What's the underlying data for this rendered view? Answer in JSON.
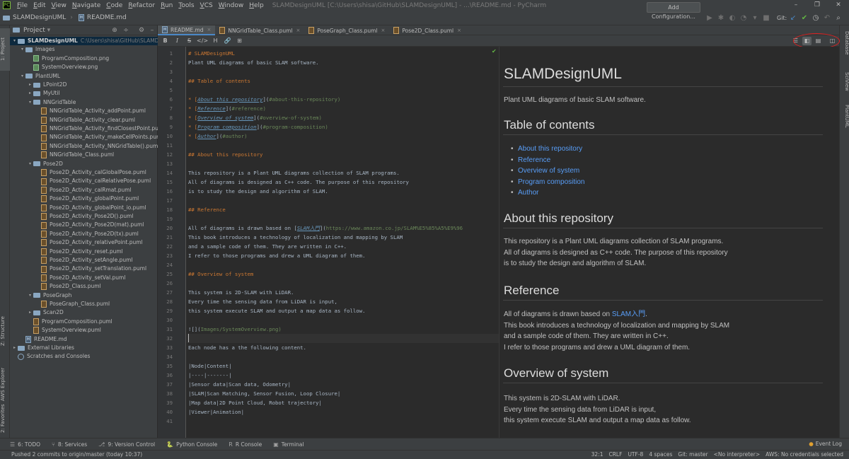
{
  "window": {
    "title": "SLAMDesignUML [C:\\Users\\shisa\\GitHub\\SLAMDesignUML] - ...\\README.md - PyCharm",
    "controls": [
      "–",
      "❐",
      "✕"
    ]
  },
  "menu": [
    {
      "ul": "F",
      "rest": "ile"
    },
    {
      "ul": "E",
      "rest": "dit"
    },
    {
      "ul": "V",
      "rest": "iew"
    },
    {
      "ul": "N",
      "rest": "avigate"
    },
    {
      "ul": "C",
      "rest": "ode"
    },
    {
      "ul": "R",
      "rest": "efactor"
    },
    {
      "ul": "R",
      "rest": "un"
    },
    {
      "ul": "T",
      "rest": "ools"
    },
    {
      "ul": "V",
      "rest": "CS"
    },
    {
      "ul": "W",
      "rest": "indow"
    },
    {
      "ul": "H",
      "rest": "elp"
    }
  ],
  "breadcrumb": {
    "project": "SLAMDesignUML",
    "file": "README.md"
  },
  "toolbar": {
    "add_config": "Add Configuration...",
    "git_label": "Git:"
  },
  "left_tool_tabs": {
    "project": "1: Project",
    "structure": "Z: Structure",
    "aws": "AWS Explorer",
    "favorites": "2: Favorites"
  },
  "right_tool_tabs": {
    "database": "Database",
    "sciview": "SciView",
    "plantuml": "PlantUML"
  },
  "project_panel": {
    "title": "Project",
    "root": {
      "name": "SLAMDesignUML",
      "path": "C:\\Users\\shisa\\GitHub\\SLAMDesignUML"
    },
    "items": [
      {
        "label": "Images",
        "icon": "folder",
        "arrow": "▾",
        "level": 1
      },
      {
        "label": "ProgramComposition.png",
        "icon": "png",
        "arrow": "",
        "level": 2
      },
      {
        "label": "SystemOverview.png",
        "icon": "png",
        "arrow": "",
        "level": 2
      },
      {
        "label": "PlantUML",
        "icon": "folder",
        "arrow": "▾",
        "level": 1
      },
      {
        "label": "LPoint2D",
        "icon": "folder",
        "arrow": "▸",
        "level": 2
      },
      {
        "label": "MyUtil",
        "icon": "folder",
        "arrow": "▸",
        "level": 2
      },
      {
        "label": "NNGridTable",
        "icon": "folder",
        "arrow": "▾",
        "level": 2
      },
      {
        "label": "NNGridTable_Activity_addPoint.puml",
        "icon": "puml",
        "arrow": "",
        "level": 3
      },
      {
        "label": "NNGridTable_Activity_clear.puml",
        "icon": "puml",
        "arrow": "",
        "level": 3
      },
      {
        "label": "NNGridTable_Activity_findClosestPoint.puml",
        "icon": "puml",
        "arrow": "",
        "level": 3
      },
      {
        "label": "NNGridTable_Activity_makeCellPoints.puml",
        "icon": "puml",
        "arrow": "",
        "level": 3
      },
      {
        "label": "NNGridTable_Activity_NNGridTable().puml",
        "icon": "puml",
        "arrow": "",
        "level": 3
      },
      {
        "label": "NNGridTable_Class.puml",
        "icon": "puml",
        "arrow": "",
        "level": 3
      },
      {
        "label": "Pose2D",
        "icon": "folder",
        "arrow": "▾",
        "level": 2
      },
      {
        "label": "Pose2D_Activity_calGlobalPose.puml",
        "icon": "puml",
        "arrow": "",
        "level": 3
      },
      {
        "label": "Pose2D_Activity_calRelativePose.puml",
        "icon": "puml",
        "arrow": "",
        "level": 3
      },
      {
        "label": "Pose2D_Activity_calRmat.puml",
        "icon": "puml",
        "arrow": "",
        "level": 3
      },
      {
        "label": "Pose2D_Activity_globalPoint.puml",
        "icon": "puml",
        "arrow": "",
        "level": 3
      },
      {
        "label": "Pose2D_Activity_globalPoint_io.puml",
        "icon": "puml",
        "arrow": "",
        "level": 3
      },
      {
        "label": "Pose2D_Activity_Pose2D().puml",
        "icon": "puml",
        "arrow": "",
        "level": 3
      },
      {
        "label": "Pose2D_Activity_Pose2D(mat).puml",
        "icon": "puml",
        "arrow": "",
        "level": 3
      },
      {
        "label": "Pose2D_Activity_Pose2D(tx).puml",
        "icon": "puml",
        "arrow": "",
        "level": 3
      },
      {
        "label": "Pose2D_Activity_relativePoint.puml",
        "icon": "puml",
        "arrow": "",
        "level": 3
      },
      {
        "label": "Pose2D_Activity_reset.puml",
        "icon": "puml",
        "arrow": "",
        "level": 3
      },
      {
        "label": "Pose2D_Activity_setAngle.puml",
        "icon": "puml",
        "arrow": "",
        "level": 3
      },
      {
        "label": "Pose2D_Activity_setTranslation.puml",
        "icon": "puml",
        "arrow": "",
        "level": 3
      },
      {
        "label": "Pose2D_Activity_setVal.puml",
        "icon": "puml",
        "arrow": "",
        "level": 3
      },
      {
        "label": "Pose2D_Class.puml",
        "icon": "puml",
        "arrow": "",
        "level": 3
      },
      {
        "label": "PoseGraph",
        "icon": "folder",
        "arrow": "▾",
        "level": 2
      },
      {
        "label": "PoseGraph_Class.puml",
        "icon": "puml",
        "arrow": "",
        "level": 3
      },
      {
        "label": "Scan2D",
        "icon": "folder",
        "arrow": "▸",
        "level": 2
      },
      {
        "label": "ProgramComposition.puml",
        "icon": "puml",
        "arrow": "",
        "level": 2
      },
      {
        "label": "SystemOverview.puml",
        "icon": "puml",
        "arrow": "",
        "level": 2
      },
      {
        "label": "README.md",
        "icon": "md",
        "arrow": "",
        "level": 1
      },
      {
        "label": "External Libraries",
        "icon": "lib",
        "arrow": "▸",
        "level": 0
      },
      {
        "label": "Scratches and Consoles",
        "icon": "scratch",
        "arrow": "",
        "level": 0
      }
    ]
  },
  "tabs": [
    {
      "label": "README.md",
      "icon": "md",
      "active": true
    },
    {
      "label": "NNGridTable_Class.puml",
      "icon": "puml",
      "active": false
    },
    {
      "label": "PoseGraph_Class.puml",
      "icon": "puml",
      "active": false
    },
    {
      "label": "Pose2D_Class.puml",
      "icon": "puml",
      "active": false
    }
  ],
  "md_toolbar": [
    "B",
    "I",
    "S",
    "</>",
    "H",
    "🔗",
    "⊞"
  ],
  "editor": {
    "caret_line": 32,
    "lines": [
      {
        "n": "1",
        "t": "# SLAMDesignUML",
        "k": "h"
      },
      {
        "n": "2",
        "t": "Plant UML diagrams of basic SLAM software.",
        "k": ""
      },
      {
        "n": "3",
        "t": "",
        "k": ""
      },
      {
        "n": "4",
        "t": "## Table of contents",
        "k": "h"
      },
      {
        "n": "5",
        "t": "",
        "k": ""
      },
      {
        "n": "6",
        "t": "* [About this repository](#about-this-repository)",
        "k": "li"
      },
      {
        "n": "7",
        "t": "* [Reference](#reference)",
        "k": "li"
      },
      {
        "n": "8",
        "t": "* [Overview of system](#overview-of-system)",
        "k": "li"
      },
      {
        "n": "9",
        "t": "* [Program composition](#program-composition)",
        "k": "li"
      },
      {
        "n": "10",
        "t": "* [Author](#author)",
        "k": "li"
      },
      {
        "n": "11",
        "t": "",
        "k": ""
      },
      {
        "n": "12",
        "t": "## About this repository",
        "k": "h"
      },
      {
        "n": "13",
        "t": "",
        "k": ""
      },
      {
        "n": "14",
        "t": "This repository is a Plant UML diagrams collection of SLAM programs.",
        "k": ""
      },
      {
        "n": "15",
        "t": "All of diagrams is designed as C++ code. The purpose of this repository",
        "k": ""
      },
      {
        "n": "16",
        "t": "is to study the design and algorithm of SLAM.",
        "k": ""
      },
      {
        "n": "17",
        "t": "",
        "k": ""
      },
      {
        "n": "18",
        "t": "## Reference",
        "k": "h"
      },
      {
        "n": "19",
        "t": "",
        "k": ""
      },
      {
        "n": "20",
        "t": "All of diagrams is drawn based on [SLAM入門](https://www.amazon.co.jp/SLAM%E5%85%A5%E9%96",
        "k": "ref"
      },
      {
        "n": "21",
        "t": "This book introduces a technology of localization and mapping by SLAM",
        "k": ""
      },
      {
        "n": "22",
        "t": "and a sample code of them. They are written in C++.",
        "k": ""
      },
      {
        "n": "23",
        "t": "I refer to those programs and drew a UML diagram of them.",
        "k": ""
      },
      {
        "n": "24",
        "t": "",
        "k": ""
      },
      {
        "n": "25",
        "t": "## Overview of system",
        "k": "h"
      },
      {
        "n": "26",
        "t": "",
        "k": ""
      },
      {
        "n": "27",
        "t": "This system is 2D-SLAM with LiDAR.",
        "k": ""
      },
      {
        "n": "28",
        "t": "Every time the sensing data from LiDAR is input,",
        "k": ""
      },
      {
        "n": "29",
        "t": "this system execute SLAM and output a map data as follow.",
        "k": ""
      },
      {
        "n": "30",
        "t": "",
        "k": ""
      },
      {
        "n": "31",
        "t": "![](Images/SystemOverview.png)",
        "k": "img"
      },
      {
        "n": "32",
        "t": "",
        "k": ""
      },
      {
        "n": "33",
        "t": "Each node has a the following content.",
        "k": ""
      },
      {
        "n": "34",
        "t": "",
        "k": ""
      },
      {
        "n": "35",
        "t": "|Node|Content|",
        "k": "tbl"
      },
      {
        "n": "36",
        "t": "|----|-------|",
        "k": "tbl"
      },
      {
        "n": "37",
        "t": "|Sensor data|Scan data, Odometry|",
        "k": "tbl"
      },
      {
        "n": "38",
        "t": "|SLAM|Scan Matching, Sensor Fusion, Loop Closure|",
        "k": "tbl"
      },
      {
        "n": "39",
        "t": "|Map data|2D Point Cloud, Robot trajectory|",
        "k": "tbl"
      },
      {
        "n": "40",
        "t": "|Viewer|Animation|",
        "k": "tbl"
      },
      {
        "n": "41",
        "t": "",
        "k": ""
      }
    ]
  },
  "preview": {
    "h1": "SLAMDesignUML",
    "intro": "Plant UML diagrams of basic SLAM software.",
    "toc_title": "Table of contents",
    "toc": [
      "About this repository",
      "Reference",
      "Overview of system",
      "Program composition",
      "Author"
    ],
    "about_title": "About this repository",
    "about_lines": [
      "This repository is a Plant UML diagrams collection of SLAM programs.",
      "All of diagrams is designed as C++ code. The purpose of this repository",
      "is to study the design and algorithm of SLAM."
    ],
    "ref_title": "Reference",
    "ref_prefix": "All of diagrams is drawn based on ",
    "ref_link": "SLAM入門",
    "ref_suffix": ".",
    "ref_lines": [
      "This book introduces a technology of localization and mapping by SLAM",
      "and a sample code of them. They are written in C++.",
      "I refer to those programs and drew a UML diagram of them."
    ],
    "overview_title": "Overview of system",
    "overview_lines": [
      "This system is 2D-SLAM with LiDAR.",
      "Every time the sensing data from LiDAR is input,",
      "this system execute SLAM and output a map data as follow."
    ]
  },
  "bottom_tools": [
    {
      "icon": "☰",
      "label": "6: TODO"
    },
    {
      "icon": "⑂",
      "label": "8: Services"
    },
    {
      "icon": "⎇",
      "label": "9: Version Control"
    },
    {
      "icon": "🐍",
      "label": "Python Console"
    },
    {
      "icon": "R",
      "label": "R Console"
    },
    {
      "icon": "▣",
      "label": "Terminal"
    }
  ],
  "event_log": "Event Log",
  "status": {
    "message": "Pushed 2 commits to origin/master (today 10:37)",
    "items": [
      "32:1",
      "CRLF",
      "UTF-8",
      "4 spaces",
      "Git: master",
      "<No interpreter>",
      "AWS: No credentials selected"
    ]
  },
  "colors": {
    "accent": "#4a88c7",
    "link": "#589df6",
    "annotation": "#e02020"
  }
}
